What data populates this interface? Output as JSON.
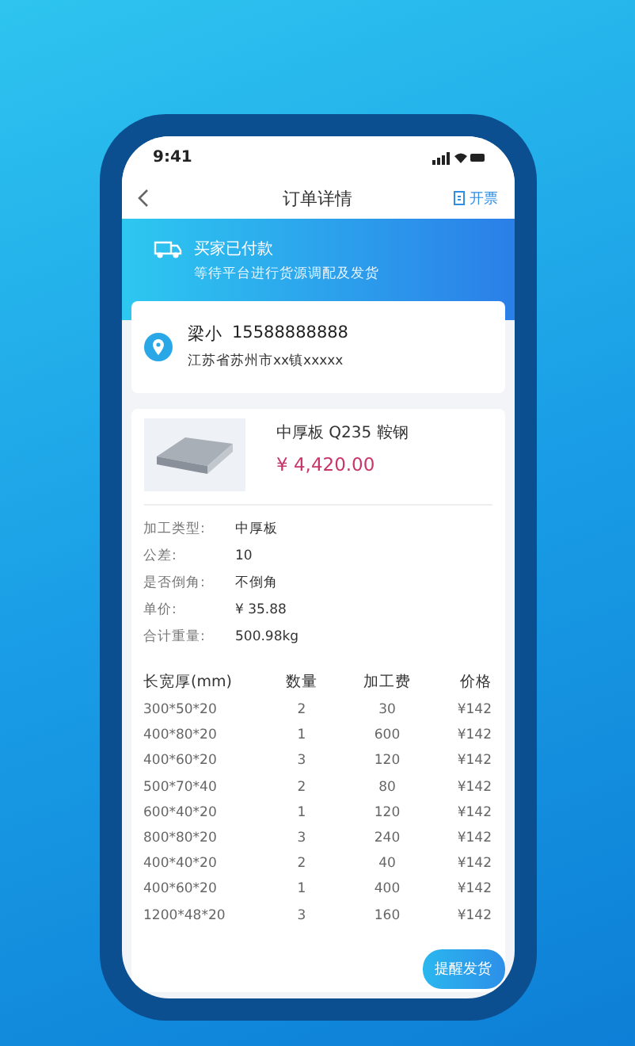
{
  "status_bar": {
    "time": "9:41"
  },
  "nav": {
    "title": "订单详情",
    "action": "开票"
  },
  "banner": {
    "title": "买家已付款",
    "subtitle": "等待平台进行货源调配及发货"
  },
  "address": {
    "name": "梁小",
    "phone": "15588888888",
    "address": "江苏省苏州市xx镇xxxxx"
  },
  "product": {
    "kind": "picture",
    "name": "中厚板 Q235 鞍钢",
    "price": "¥ 4,420.00"
  },
  "specs": [
    {
      "label": "加工类型:",
      "value": "中厚板"
    },
    {
      "label": "公差:",
      "value": "10"
    },
    {
      "label": "是否倒角:",
      "value": "不倒角"
    },
    {
      "label": "单价:",
      "value": "¥ 35.88"
    },
    {
      "label": "合计重量:",
      "value": "500.98kg"
    }
  ],
  "table": {
    "columns": [
      "长宽厚(mm)",
      "数量",
      "加工费",
      "价格"
    ],
    "rows": [
      [
        "300*50*20",
        "2",
        "30",
        "¥142"
      ],
      [
        "400*80*20",
        "1",
        "600",
        "¥142"
      ],
      [
        "400*60*20",
        "3",
        "120",
        "¥142"
      ],
      [
        "500*70*40",
        "2",
        "80",
        "¥142"
      ],
      [
        "600*40*20",
        "1",
        "120",
        "¥142"
      ],
      [
        "800*80*20",
        "3",
        "240",
        "¥142"
      ],
      [
        "400*40*20",
        "2",
        "40",
        "¥142"
      ],
      [
        "400*60*20",
        "1",
        "400",
        "¥142"
      ],
      [
        "1200*48*20",
        "3",
        "160",
        "¥142"
      ]
    ]
  },
  "button": "提醒发货"
}
